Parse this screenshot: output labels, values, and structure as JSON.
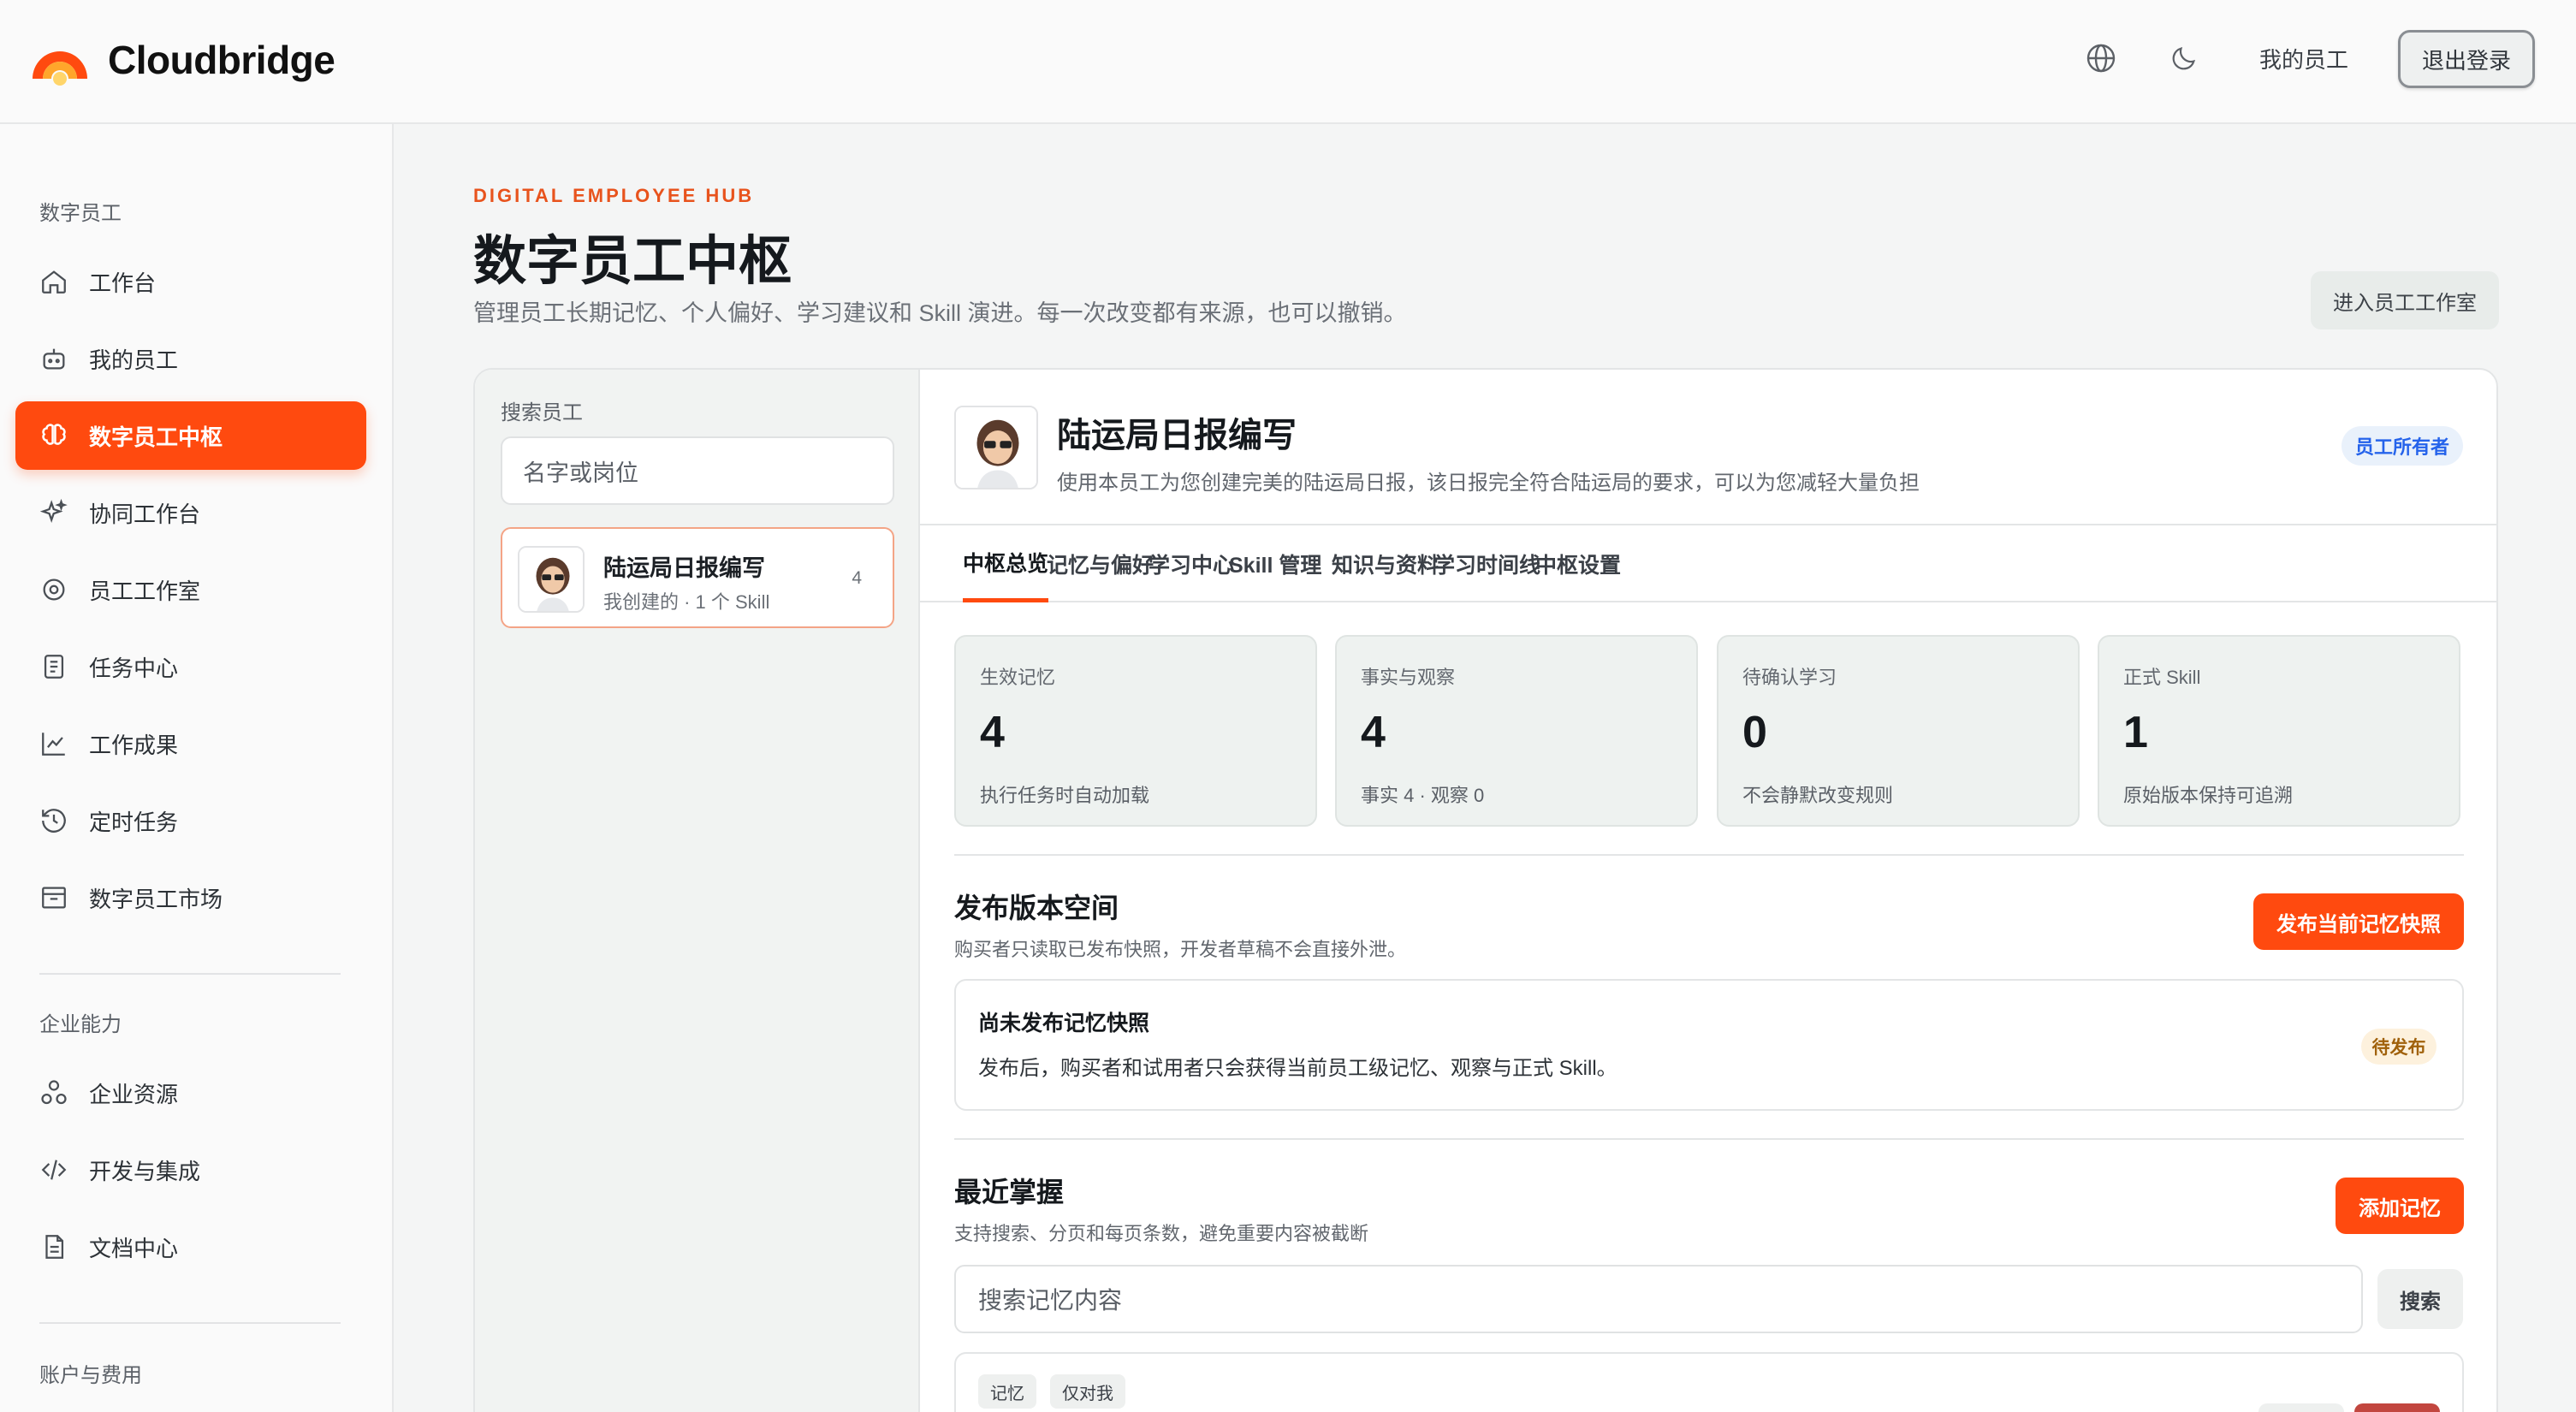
{
  "app": {
    "brand": "Cloudbridge"
  },
  "header": {
    "my_employees": "我的员工",
    "logout": "退出登录"
  },
  "sidebar": {
    "section1": "数字员工",
    "items": [
      {
        "label": "工作台",
        "icon": "home-icon"
      },
      {
        "label": "我的员工",
        "icon": "robot-icon"
      },
      {
        "label": "数字员工中枢",
        "icon": "brain-icon",
        "active": true
      },
      {
        "label": "协同工作台",
        "icon": "sparkle-icon"
      },
      {
        "label": "员工工作室",
        "icon": "gear-icon"
      },
      {
        "label": "任务中心",
        "icon": "clipboard-icon"
      },
      {
        "label": "工作成果",
        "icon": "chart-line-icon"
      },
      {
        "label": "定时任务",
        "icon": "history-icon"
      },
      {
        "label": "数字员工市场",
        "icon": "store-icon"
      }
    ],
    "section2": "企业能力",
    "items2": [
      {
        "label": "企业资源",
        "icon": "shapes-icon"
      },
      {
        "label": "开发与集成",
        "icon": "code-icon"
      },
      {
        "label": "文档中心",
        "icon": "document-icon"
      }
    ],
    "section3": "账户与费用"
  },
  "page": {
    "eyebrow": "DIGITAL EMPLOYEE HUB",
    "title": "数字员工中枢",
    "subtitle": "管理员工长期记忆、个人偏好、学习建议和 Skill 演进。每一次改变都有来源，也可以撤销。",
    "studio_button": "进入员工工作室"
  },
  "employee_list": {
    "search_label": "搜索员工",
    "search_placeholder": "名字或岗位",
    "items": [
      {
        "name": "陆运局日报编写",
        "meta": "我创建的 · 1 个 Skill",
        "count": "4"
      }
    ]
  },
  "detail": {
    "name": "陆运局日报编写",
    "description": "使用本员工为您创建完美的陆运局日报，该日报完全符合陆运局的要求，可以为您减轻大量负担",
    "owner_badge": "员工所有者",
    "tabs": [
      "中枢总览",
      "记忆与偏好",
      "学习中心",
      "Skill 管理",
      "知识与资料",
      "学习时间线",
      "中枢设置"
    ],
    "stats": [
      {
        "label": "生效记忆",
        "value": "4",
        "note": "执行任务时自动加载"
      },
      {
        "label": "事实与观察",
        "value": "4",
        "note": "事实 4 · 观察 0"
      },
      {
        "label": "待确认学习",
        "value": "0",
        "note": "不会静默改变规则"
      },
      {
        "label": "正式 Skill",
        "value": "1",
        "note": "原始版本保持可追溯"
      }
    ],
    "publish": {
      "title": "发布版本空间",
      "subtitle": "购买者只读取已发布快照，开发者草稿不会直接外泄。",
      "button": "发布当前记忆快照",
      "box_title": "尚未发布记忆快照",
      "box_desc": "发布后，购买者和试用者只会获得当前员工级记忆、观察与正式 Skill。",
      "status": "待发布"
    },
    "recent": {
      "title": "最近掌握",
      "subtitle": "支持搜索、分页和每页条数，避免重要内容被截断",
      "button": "添加记忆",
      "search_placeholder": "搜索记忆内容",
      "search_button": "搜索",
      "chips": [
        "记忆",
        "仅对我"
      ]
    }
  },
  "colors": {
    "accent": "#ff4a0f",
    "owner_badge": "#2563eb"
  }
}
